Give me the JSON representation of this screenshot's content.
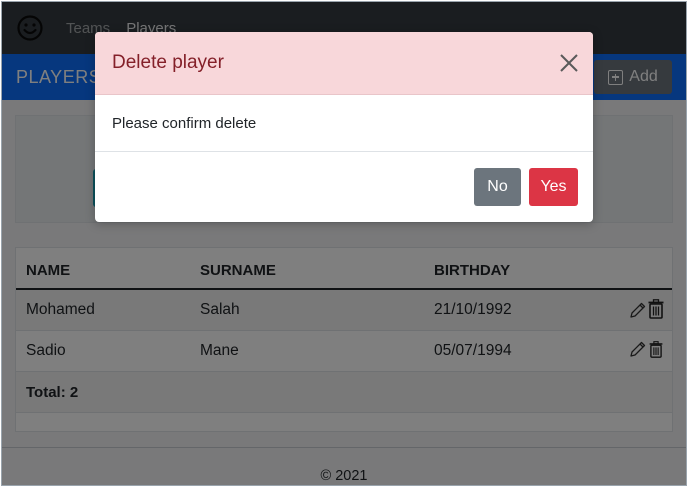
{
  "navbar": {
    "brand_icon": "smiley-face-icon",
    "links": [
      {
        "label": "Teams"
      },
      {
        "label": "Players"
      }
    ]
  },
  "subheader": {
    "title": "PLAYERS",
    "add_label": "Add",
    "add_icon": "plus-square-icon"
  },
  "table": {
    "headers": [
      "NAME",
      "SURNAME",
      "BIRTHDAY"
    ],
    "rows": [
      {
        "name": "Mohamed",
        "surname": "Salah",
        "birthday": "21/10/1992"
      },
      {
        "name": "Sadio",
        "surname": "Mane",
        "birthday": "05/07/1994"
      }
    ],
    "total": "Total: 2",
    "row_icons": [
      "pencil-icon",
      "trash-icon"
    ]
  },
  "footer": {
    "text": "© 2021"
  },
  "modal": {
    "title": "Delete player",
    "body": "Please confirm delete",
    "no_label": "No",
    "yes_label": "Yes",
    "close_icon": "close-icon"
  },
  "colors": {
    "navbar_bg": "#343a40",
    "primary": "#0d6efd",
    "secondary": "#6c757d",
    "danger": "#dc3545",
    "modal_header_bg": "#f8d7da",
    "modal_title": "#842029"
  }
}
